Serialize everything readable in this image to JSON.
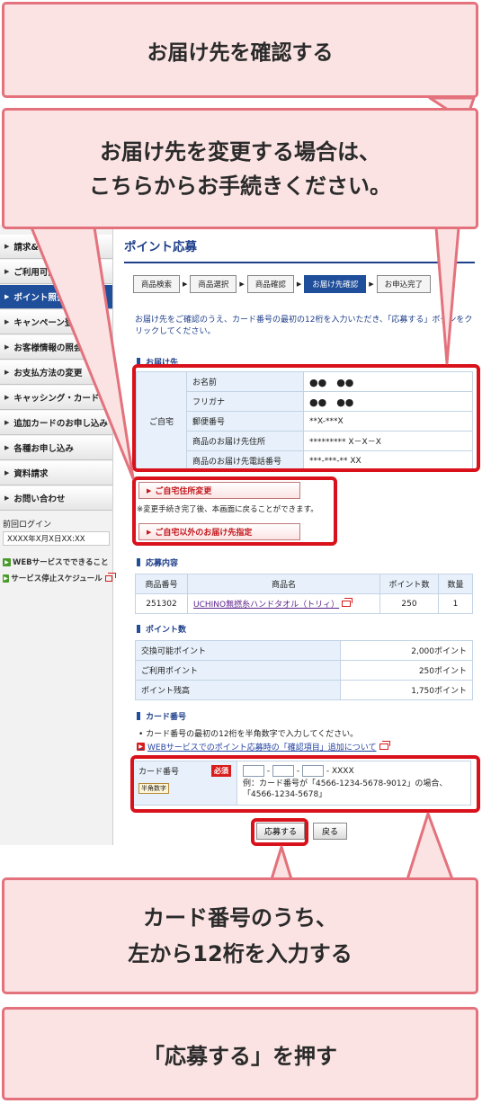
{
  "callouts": {
    "confirm_title": "お届け先を確認する",
    "change_line1": "お届け先を変更する場合は、",
    "change_line2": "こちらからお手続きください。",
    "card_line1": "カード番号のうち、",
    "card_line2": "左から12桁を入力する",
    "apply": "「応募する」を押す"
  },
  "sidebar": {
    "items": [
      {
        "label": "請求&ご利用明細照会"
      },
      {
        "label": "ご利用可能額照会"
      },
      {
        "label": "ポイント照会"
      },
      {
        "label": "キャンペーン登録・確認"
      },
      {
        "label": "お客様情報の照会・変更"
      },
      {
        "label": "お支払方法の変更"
      },
      {
        "label": "キャッシング・カードローン"
      },
      {
        "label": "追加カードのお申し込み"
      },
      {
        "label": "各種お申し込み"
      },
      {
        "label": "資料請求"
      },
      {
        "label": "お問い合わせ"
      }
    ],
    "last_login_label": "前回ログイン",
    "last_login_time": "XXXX年X月X日XX:XX",
    "link_web_services": "WEBサービスでできること",
    "link_stop_schedule": "サービス停止スケジュール"
  },
  "main": {
    "title": "ポイント応募",
    "steps": [
      "商品検索",
      "商品選択",
      "商品確認",
      "お届け先確認",
      "お申込完了"
    ],
    "intro": "お届け先をご確認のうえ、カード番号の最初の12桁を入力いただき、「応募する」ボタンをクリックしてください。",
    "address_section": "お届け先",
    "home_label": "ご自宅",
    "address_rows": [
      {
        "field": "お名前",
        "value": "●●　●●"
      },
      {
        "field": "フリガナ",
        "value": "●●　●●"
      },
      {
        "field": "郵便番号",
        "value": "**X-***X"
      },
      {
        "field": "商品のお届け先住所",
        "value": "********* X－X－X"
      },
      {
        "field": "商品のお届け先電話番号",
        "value": "***-***-** XX"
      }
    ],
    "change_home_button": "ご自宅住所変更",
    "change_note": "※変更手続き完了後、本画面に戻ることができます。",
    "other_address_button": "ご自宅以外のお届け先指定",
    "order_section": "応募内容",
    "order_headers": [
      "商品番号",
      "商品名",
      "ポイント数",
      "数量"
    ],
    "order_row": {
      "code": "251302",
      "name": "UCHINO無撚糸ハンドタオル（トリィ）",
      "points": "250",
      "qty": "1"
    },
    "points_section": "ポイント数",
    "points_rows": [
      {
        "label": "交換可能ポイント",
        "value": "2,000ポイント"
      },
      {
        "label": "ご利用ポイント",
        "value": "250ポイント"
      },
      {
        "label": "ポイント残高",
        "value": "1,750ポイント"
      }
    ],
    "card_section": "カード番号",
    "card_instruction": "カード番号の最初の12桁を半角数字で入力してください。",
    "card_link": "WEBサービスでのポイント応募時の「確認項目」追加について",
    "card_label": "カード番号",
    "required_badge": "必須",
    "halfwidth_badge": "半角数字",
    "card_suffix": "- XXXX",
    "card_example_1": "例：カード番号が「4566-1234-5678-9012」の場合、",
    "card_example_2": "「4566-1234-5678」",
    "apply_button": "応募する",
    "back_button": "戻る"
  },
  "colors": {
    "accent_red": "#d9111b",
    "callout_fill": "#fbe3e3",
    "callout_border": "#e3727c",
    "brand_blue": "#1f4e9a"
  }
}
